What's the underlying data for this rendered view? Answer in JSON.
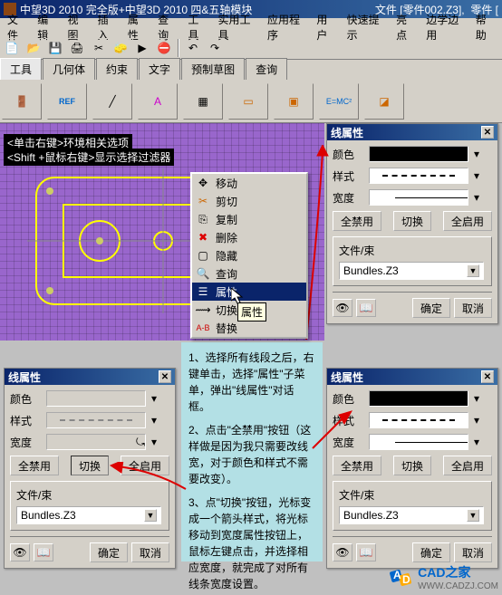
{
  "app": {
    "title": "中望3D 2010 完全版+中望3D 2010 四&五轴模块",
    "file_prefix": "文件",
    "file_name": "[零件002.Z3],",
    "part": "零件 ["
  },
  "menu": [
    "文件",
    "编辑",
    "视图",
    "插入",
    "属性",
    "查询",
    "工具",
    "实用工具",
    "应用程序",
    "用户",
    "快速提示",
    "亮点",
    "边学边用",
    "帮助"
  ],
  "tabs": [
    "工具",
    "几何体",
    "约束",
    "文字",
    "预制草图",
    "查询"
  ],
  "hints": {
    "h1": "<单击右键>环境相关选项",
    "h2": "<Shift +鼠标右键>显示选择过滤器"
  },
  "ctx": {
    "move": "移动",
    "cut": "剪切",
    "copy": "复制",
    "delete": "删除",
    "hide": "隐藏",
    "query": "查询",
    "props": "属性",
    "switchprops": "切换属性",
    "replace": "替换"
  },
  "tooltip_props": "属性",
  "panel": {
    "title": "线属性",
    "color": "颜色",
    "style": "样式",
    "width": "宽度",
    "disable_all": "全禁用",
    "toggle": "切换",
    "enable_all": "全启用",
    "file_bundle": "文件/束",
    "bundle_val": "Bundles.Z3",
    "ok": "确定",
    "cancel": "取消"
  },
  "annot": {
    "s1": "1、选择所有线段之后，右键单击，选择\"属性\"子菜单，弹出\"线属性\"对话框。",
    "s2": "2、点击\"全禁用\"按钮（这样做是因为我只需要改线宽，对于颜色和样式不需要改变）。",
    "s3": "3、点\"切换\"按钮，光标变成一个箭头样式，将光标移动到宽度属性按钮上，鼠标左键点击，并选择相应宽度，就完成了对所有线条宽度设置。"
  },
  "wm": {
    "brand": "CAD之家",
    "url": "WWW.CADZJ.COM"
  }
}
